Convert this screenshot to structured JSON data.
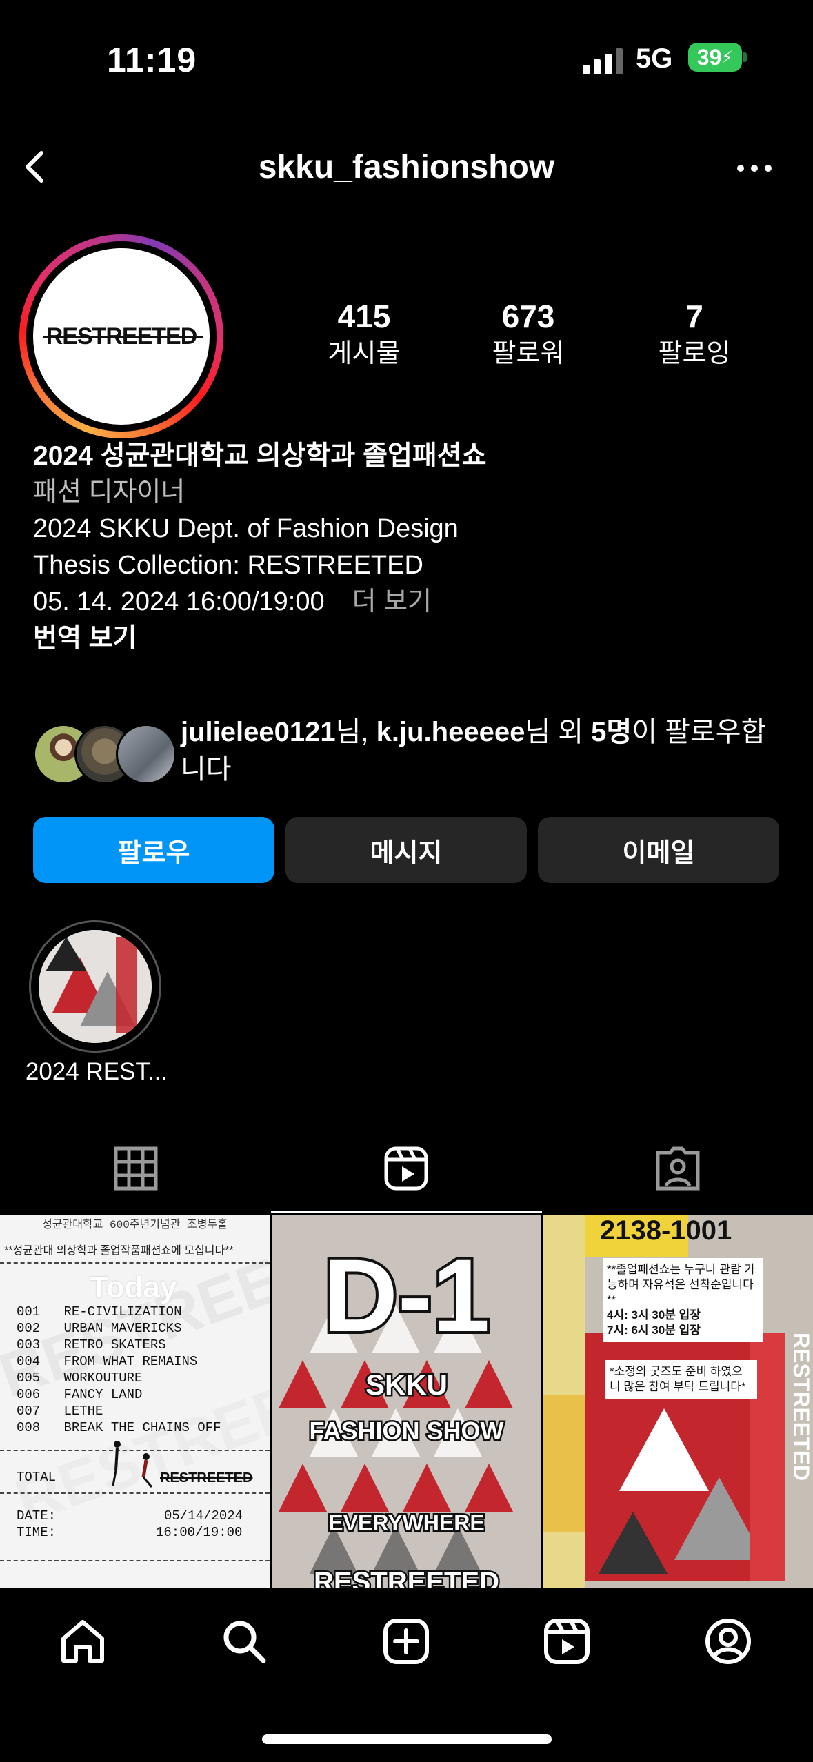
{
  "status_bar": {
    "time": "11:19",
    "network": "5G",
    "battery": "39"
  },
  "header": {
    "username": "skku_fashionshow"
  },
  "profile": {
    "avatar_text": "RESTREETED",
    "stats": [
      {
        "value": "415",
        "label": "게시물"
      },
      {
        "value": "673",
        "label": "팔로워"
      },
      {
        "value": "7",
        "label": "팔로잉"
      }
    ],
    "bio": {
      "name": "2024 성균관대학교 의상학과 졸업패션쇼",
      "category": "패션 디자이너",
      "line1": "2024 SKKU Dept. of Fashion Design",
      "line2": "Thesis Collection: RESTREETED",
      "line3": "05. 14. 2024 16:00/19:00",
      "more": "더 보기",
      "translate": "번역 보기"
    },
    "mutual": {
      "user1": "julielee0121",
      "sep1": "님, ",
      "user2": "k.ju.heeeee",
      "sep2": "님 외 ",
      "count": "5명",
      "rest": "이 팔로우합니다"
    },
    "buttons": {
      "follow": "팔로우",
      "message": "메시지",
      "email": "이메일"
    }
  },
  "highlights": [
    {
      "label": "2024 REST..."
    }
  ],
  "posts": {
    "tile1": {
      "header": "성균관대학교 600주년기념관 조병두홀",
      "invite": "**성균관대 의상학과 졸업작품패션쇼에 모십니다**",
      "today": "Today",
      "items": [
        {
          "no": "001",
          "title": "RE-CIVILIZATION"
        },
        {
          "no": "002",
          "title": "URBAN MAVERICKS"
        },
        {
          "no": "003",
          "title": "RETRO SKATERS"
        },
        {
          "no": "004",
          "title": "FROM WHAT REMAINS"
        },
        {
          "no": "005",
          "title": "WORKOUTURE"
        },
        {
          "no": "006",
          "title": "FANCY LAND"
        },
        {
          "no": "007",
          "title": "LETHE"
        },
        {
          "no": "008",
          "title": "BREAK THE CHAINS OFF"
        }
      ],
      "total_label": "TOTAL",
      "total_value": "RESTREETED",
      "date_label": "DATE:",
      "date_value": "05/14/2024",
      "time_label": "TIME:",
      "time_value": "16:00/19:00"
    },
    "tile2": {
      "big": "D-1",
      "line1": "SKKU",
      "line2": "FASHION SHOW",
      "line3": "EVERYWHERE",
      "line4": "RESTREETED"
    },
    "tile3": {
      "phone": "2138-1001",
      "note1": "**졸업패션쇼는 누구나 관람 가능하며 자유석은 선착순입니다**",
      "note2": "4시: 3시 30분 입장",
      "note3": "7시: 6시 30분 입장",
      "note4": "*소정의 굿즈도 준비 하였으니 많은 참여 부탁 드립니다*",
      "poster": "RESTREETED"
    }
  },
  "colors": {
    "follow_blue": "#0095f6",
    "button_gray": "#262626",
    "battery_green": "#34c759",
    "muted_text": "#a8a8a8"
  }
}
